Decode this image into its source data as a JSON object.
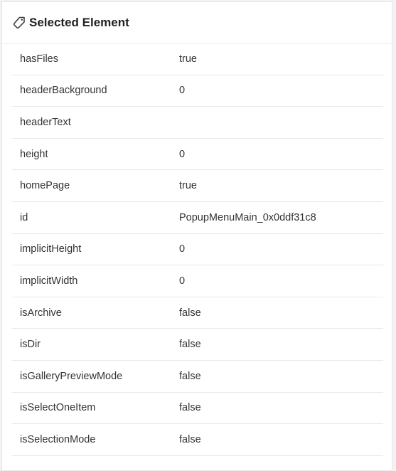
{
  "panel": {
    "title": "Selected Element",
    "icon": "tag-icon"
  },
  "properties": [
    {
      "key": "hasFiles",
      "value": "true"
    },
    {
      "key": "headerBackground",
      "value": "0"
    },
    {
      "key": "headerText",
      "value": ""
    },
    {
      "key": "height",
      "value": "0"
    },
    {
      "key": "homePage",
      "value": "true"
    },
    {
      "key": "id",
      "value": "PopupMenuMain_0x0ddf31c8"
    },
    {
      "key": "implicitHeight",
      "value": "0"
    },
    {
      "key": "implicitWidth",
      "value": "0"
    },
    {
      "key": "isArchive",
      "value": "false"
    },
    {
      "key": "isDir",
      "value": "false"
    },
    {
      "key": "isGalleryPreviewMode",
      "value": "false"
    },
    {
      "key": "isSelectOneItem",
      "value": "false"
    },
    {
      "key": "isSelectionMode",
      "value": "false"
    }
  ]
}
